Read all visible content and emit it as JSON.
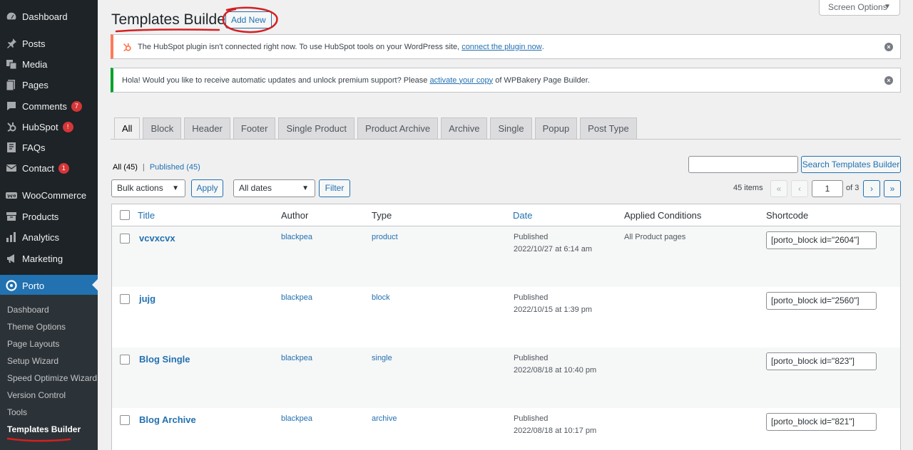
{
  "sidebar": {
    "items": [
      {
        "label": "Dashboard",
        "icon": "dashboard-icon",
        "badge": ""
      },
      {
        "label": "Posts",
        "icon": "pin-icon",
        "badge": ""
      },
      {
        "label": "Media",
        "icon": "media-icon",
        "badge": ""
      },
      {
        "label": "Pages",
        "icon": "pages-icon",
        "badge": ""
      },
      {
        "label": "Comments",
        "icon": "comment-icon",
        "badge": "7"
      },
      {
        "label": "HubSpot",
        "icon": "hubspot-icon",
        "badge": "!"
      },
      {
        "label": "FAQs",
        "icon": "faq-icon",
        "badge": ""
      },
      {
        "label": "Contact",
        "icon": "mail-icon",
        "badge": "1"
      },
      {
        "label": "WooCommerce",
        "icon": "woo-icon",
        "badge": ""
      },
      {
        "label": "Products",
        "icon": "archive-icon",
        "badge": ""
      },
      {
        "label": "Analytics",
        "icon": "bar-chart-icon",
        "badge": ""
      },
      {
        "label": "Marketing",
        "icon": "megaphone-icon",
        "badge": ""
      },
      {
        "label": "Porto",
        "icon": "porto-icon",
        "badge": ""
      }
    ],
    "submenu": [
      "Dashboard",
      "Theme Options",
      "Page Layouts",
      "Setup Wizard",
      "Speed Optimize Wizard",
      "Version Control",
      "Tools",
      "Templates Builder"
    ]
  },
  "header": {
    "title": "Templates Builder",
    "add_new": "Add New",
    "screen_options": "Screen Options"
  },
  "notices": {
    "hubspot": {
      "text": "The HubSpot plugin isn't connected right now. To use HubSpot tools on your WordPress site,",
      "link": "connect the plugin now",
      "end": "."
    },
    "wpbakery": {
      "text": "Hola! Would you like to receive automatic updates and unlock premium support? Please",
      "link": "activate your copy",
      "end": "of WPBakery Page Builder."
    }
  },
  "tabs": [
    "All",
    "Block",
    "Header",
    "Footer",
    "Single Product",
    "Product Archive",
    "Archive",
    "Single",
    "Popup",
    "Post Type"
  ],
  "views": {
    "all": "All",
    "all_count": "(45)",
    "sep": "|",
    "published": "Published",
    "published_count": "(45)"
  },
  "search": {
    "button": "Search Templates Builder",
    "value": ""
  },
  "bulk": {
    "actions": "Bulk actions",
    "apply": "Apply",
    "dates": "All dates",
    "filter": "Filter"
  },
  "pagination": {
    "items": "45 items",
    "first": "«",
    "prev": "‹",
    "current": "1",
    "of": "of 3",
    "next": "›",
    "last": "»"
  },
  "table": {
    "columns": {
      "title": "Title",
      "author": "Author",
      "type": "Type",
      "date": "Date",
      "conditions": "Applied Conditions",
      "shortcode": "Shortcode"
    },
    "rows": [
      {
        "title": "vcvxcvx",
        "author": "blackpea",
        "type": "product",
        "status": "Published",
        "date": "2022/10/27 at 6:14 am",
        "conditions": "All Product pages",
        "shortcode": "[porto_block id=\"2604\"]"
      },
      {
        "title": "jujg",
        "author": "blackpea",
        "type": "block",
        "status": "Published",
        "date": "2022/10/15 at 1:39 pm",
        "conditions": "",
        "shortcode": "[porto_block id=\"2560\"]"
      },
      {
        "title": "Blog Single",
        "author": "blackpea",
        "type": "single",
        "status": "Published",
        "date": "2022/08/18 at 10:40 pm",
        "conditions": "",
        "shortcode": "[porto_block id=\"823\"]"
      },
      {
        "title": "Blog Archive",
        "author": "blackpea",
        "type": "archive",
        "status": "Published",
        "date": "2022/08/18 at 10:17 pm",
        "conditions": "",
        "shortcode": "[porto_block id=\"821\"]"
      }
    ]
  },
  "colors": {
    "sidebar": "#1d2327",
    "accent": "#2271b1",
    "hubspot_notice": "#ff7a59",
    "success_notice": "#00a32a",
    "annotation": "#d61f1f"
  }
}
